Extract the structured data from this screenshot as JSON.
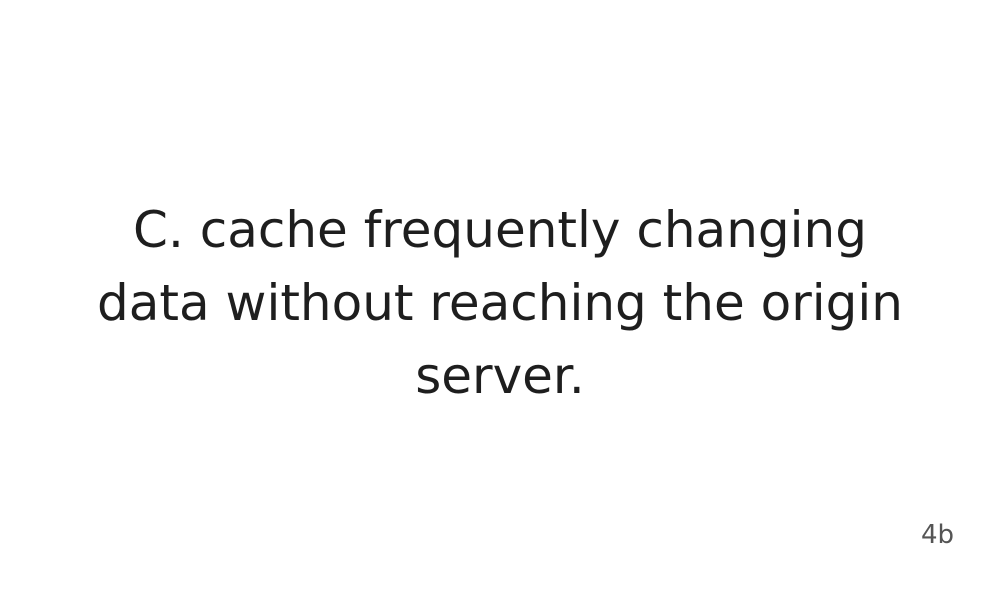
{
  "slide": {
    "answer_text": "C. cache frequently changing data without reaching the origin server.",
    "page_number": "4b"
  },
  "colors": {
    "background": "#ffffff",
    "text": "#1e1e1e",
    "page_number": "#555555"
  }
}
